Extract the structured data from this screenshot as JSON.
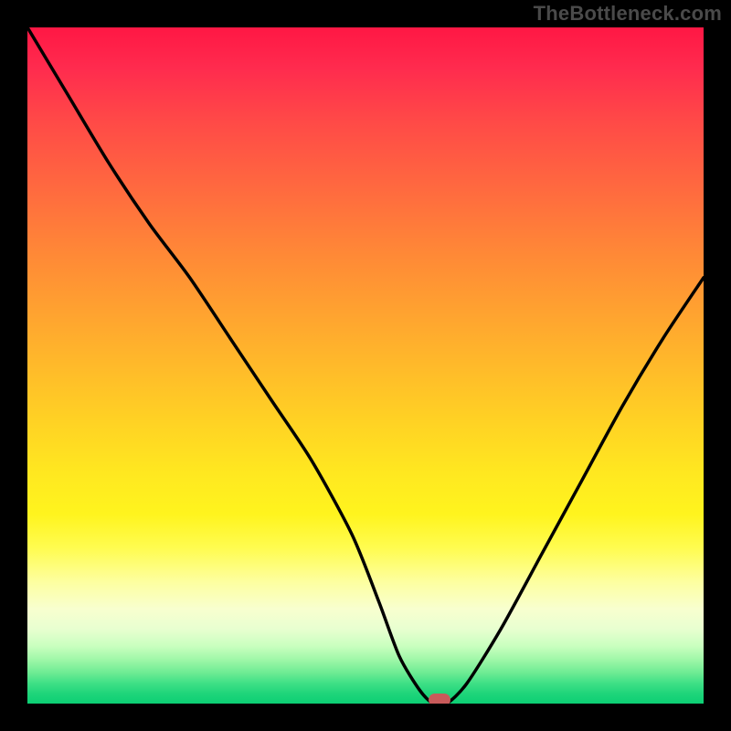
{
  "watermark": "TheBottleneck.com",
  "chart_data": {
    "type": "line",
    "title": "",
    "xlabel": "",
    "ylabel": "",
    "xlim": [
      0,
      100
    ],
    "ylim": [
      0,
      100
    ],
    "x": [
      0,
      6,
      12,
      18,
      24,
      30,
      36,
      42,
      48,
      52,
      55,
      58,
      60,
      62,
      65,
      70,
      76,
      82,
      88,
      94,
      100
    ],
    "values": [
      100,
      90,
      80,
      71,
      63,
      54,
      45,
      36,
      25,
      15,
      7,
      2,
      0,
      0,
      3,
      11,
      22,
      33,
      44,
      54,
      63
    ],
    "marker": {
      "x": 61,
      "y": 0
    },
    "background_gradient": {
      "orientation": "vertical",
      "stops": [
        {
          "pos": 0,
          "color": "#ff1744"
        },
        {
          "pos": 24,
          "color": "#ff6a3f"
        },
        {
          "pos": 58,
          "color": "#ffd124"
        },
        {
          "pos": 82,
          "color": "#fdffa0"
        },
        {
          "pos": 93,
          "color": "#9ff7a8"
        },
        {
          "pos": 100,
          "color": "#0ccf74"
        }
      ]
    }
  }
}
